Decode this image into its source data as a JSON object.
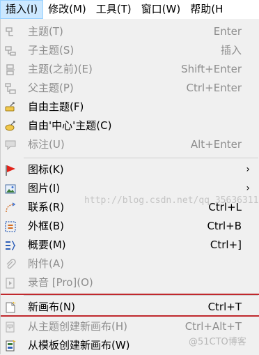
{
  "menubar": {
    "items": [
      {
        "label": "插入(I)",
        "active": true
      },
      {
        "label": "修改(M)"
      },
      {
        "label": "工具(T)"
      },
      {
        "label": "窗口(W)"
      },
      {
        "label": "帮助(H"
      }
    ]
  },
  "menu": {
    "items": [
      {
        "label": "主题(T)",
        "shortcut": "Enter",
        "enabled": false,
        "icon": "topic-icon"
      },
      {
        "label": "子主题(S)",
        "shortcut": "插入",
        "enabled": false,
        "icon": "subtopic-icon"
      },
      {
        "label": "主题(之前)(E)",
        "shortcut": "Shift+Enter",
        "enabled": false,
        "icon": "topic-before-icon"
      },
      {
        "label": "父主题(P)",
        "shortcut": "Ctrl+Enter",
        "enabled": false,
        "icon": "parent-topic-icon"
      },
      {
        "label": "自由主题(F)",
        "shortcut": "",
        "enabled": true,
        "icon": "free-topic-icon"
      },
      {
        "label": "自由'中心'主题(C)",
        "shortcut": "",
        "enabled": true,
        "icon": "free-central-topic-icon"
      },
      {
        "label": "标注(U)",
        "shortcut": "Alt+Enter",
        "enabled": false,
        "icon": "callout-icon"
      },
      {
        "label": "图标(K)",
        "shortcut": "",
        "submenu": true,
        "enabled": true,
        "icon": "flag-icon"
      },
      {
        "label": "图片(I)",
        "shortcut": "",
        "submenu": true,
        "enabled": true,
        "icon": "image-icon"
      },
      {
        "label": "联系(R)",
        "shortcut": "Ctrl+L",
        "enabled": true,
        "icon": "relationship-icon"
      },
      {
        "label": "外框(B)",
        "shortcut": "Ctrl+B",
        "enabled": true,
        "icon": "boundary-icon"
      },
      {
        "label": "概要(M)",
        "shortcut": "Ctrl+]",
        "enabled": true,
        "icon": "summary-icon"
      },
      {
        "label": "附件(A)",
        "shortcut": "",
        "enabled": false,
        "icon": "attachment-icon"
      },
      {
        "label": "录音 [Pro](O)",
        "shortcut": "",
        "enabled": false,
        "icon": "audio-record-icon"
      },
      {
        "label": "新画布(N)",
        "shortcut": "Ctrl+T",
        "enabled": true,
        "icon": "new-sheet-icon",
        "highlighted": true
      },
      {
        "label": "从主题创建新画布(H)",
        "shortcut": "Ctrl+Alt+T",
        "enabled": false,
        "icon": "sheet-from-topic-icon"
      },
      {
        "label": "从模板创建新画布(W)",
        "shortcut": "",
        "enabled": true,
        "icon": "sheet-from-template-icon"
      }
    ],
    "submenu_arrow": "›"
  },
  "watermark": "http://blog.csdn.net/qq_35636311",
  "watermark2": "@51CTO博客",
  "colors": {
    "highlight_border": "#c0282d",
    "menubar_active": "#cce8ff",
    "disabled_text": "#8d8d8d"
  }
}
